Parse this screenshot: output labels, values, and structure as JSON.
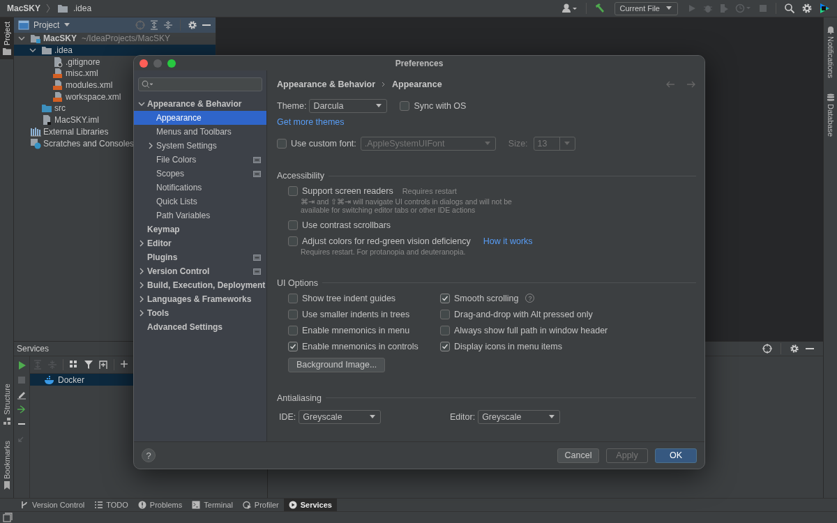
{
  "navbar": {
    "project": "MacSKY",
    "path": ".idea",
    "run_config": "Current File"
  },
  "left_stripe": [
    {
      "label": "Project",
      "kind": "project",
      "selected": true
    },
    {
      "label": "Structure",
      "kind": "structure",
      "selected": false
    },
    {
      "label": "Bookmarks",
      "kind": "bookmarks",
      "selected": false
    }
  ],
  "right_stripe": [
    {
      "label": "Notifications",
      "kind": "bell"
    },
    {
      "label": "Database",
      "kind": "database"
    }
  ],
  "project_panel": {
    "title": "Project",
    "tree": [
      {
        "name": "MacSKY",
        "detail": "~/IdeaProjects/MacSKY",
        "kind": "module",
        "expanded": true,
        "selected": false,
        "children": [
          {
            "name": ".idea",
            "kind": "folder",
            "expanded": true,
            "selected": true,
            "children": [
              {
                "name": ".gitignore",
                "kind": "ignore",
                "selected": false
              },
              {
                "name": "misc.xml",
                "kind": "xml",
                "selected": false
              },
              {
                "name": "modules.xml",
                "kind": "xml",
                "selected": false
              },
              {
                "name": "workspace.xml",
                "kind": "xml",
                "selected": false
              }
            ]
          },
          {
            "name": "src",
            "kind": "source",
            "selected": false
          },
          {
            "name": "MacSKY.iml",
            "kind": "iml",
            "selected": false
          }
        ]
      },
      {
        "name": "External Libraries",
        "kind": "libraries",
        "selected": false
      },
      {
        "name": "Scratches and Consoles",
        "kind": "scratches",
        "selected": false
      }
    ]
  },
  "services_panel": {
    "title": "Services",
    "items": [
      {
        "name": "Docker",
        "selected": true
      }
    ]
  },
  "bottom_tabs": [
    {
      "label": "Version Control",
      "kind": "branch",
      "selected": false
    },
    {
      "label": "TODO",
      "kind": "list",
      "selected": false
    },
    {
      "label": "Problems",
      "kind": "problems",
      "selected": false
    },
    {
      "label": "Terminal",
      "kind": "terminal",
      "selected": false
    },
    {
      "label": "Profiler",
      "kind": "profiler",
      "selected": false
    },
    {
      "label": "Services",
      "kind": "services",
      "selected": true
    }
  ],
  "dialog": {
    "title": "Preferences",
    "nav": [
      {
        "label": "Appearance & Behavior",
        "expanded": true,
        "selected": false,
        "children": [
          {
            "label": "Appearance",
            "selected": true
          },
          {
            "label": "Menus and Toolbars",
            "selected": false
          },
          {
            "label": "System Settings",
            "expanded": false,
            "selected": false
          },
          {
            "label": "File Colors",
            "selected": false,
            "project_level": true
          },
          {
            "label": "Scopes",
            "selected": false,
            "project_level": true
          },
          {
            "label": "Notifications",
            "selected": false
          },
          {
            "label": "Quick Lists",
            "selected": false
          },
          {
            "label": "Path Variables",
            "selected": false
          }
        ]
      },
      {
        "label": "Keymap",
        "selected": false
      },
      {
        "label": "Editor",
        "expanded": false,
        "selected": false
      },
      {
        "label": "Plugins",
        "selected": false,
        "project_level": true
      },
      {
        "label": "Version Control",
        "expanded": false,
        "selected": false,
        "project_level": true
      },
      {
        "label": "Build, Execution, Deployment",
        "expanded": false,
        "selected": false
      },
      {
        "label": "Languages & Frameworks",
        "expanded": false,
        "selected": false
      },
      {
        "label": "Tools",
        "expanded": false,
        "selected": false
      },
      {
        "label": "Advanced Settings",
        "selected": false
      }
    ],
    "breadcrumb": [
      "Appearance & Behavior",
      "Appearance"
    ],
    "theme": {
      "label": "Theme:",
      "value": "Darcula"
    },
    "sync": {
      "label": "Sync with OS",
      "checked": false
    },
    "themes_link": "Get more themes",
    "custom_font": {
      "label": "Use custom font:",
      "checked": false,
      "value": ".AppleSystemUIFont",
      "size_label": "Size:",
      "size": "13"
    },
    "accessibility": {
      "title": "Accessibility",
      "options": [
        {
          "label": "Support screen readers",
          "checked": false,
          "note": "Requires restart",
          "hint": "⌘⇥ and ⇧⌘⇥ will navigate UI controls in dialogs and will not be available for switching editor tabs or other IDE actions"
        },
        {
          "label": "Use contrast scrollbars",
          "checked": false
        },
        {
          "label": "Adjust colors for red-green vision deficiency",
          "checked": false,
          "link": "How it works",
          "hint": "Requires restart. For protanopia and deuteranopia."
        }
      ]
    },
    "ui_options": {
      "title": "UI Options",
      "left": [
        {
          "label": "Show tree indent guides",
          "checked": false
        },
        {
          "label": "Use smaller indents in trees",
          "checked": false
        },
        {
          "label": "Enable mnemonics in menu",
          "checked": false
        },
        {
          "label": "Enable mnemonics in controls",
          "checked": true
        }
      ],
      "right": [
        {
          "label": "Smooth scrolling",
          "checked": true,
          "help": "?"
        },
        {
          "label": "Drag-and-drop with Alt pressed only",
          "checked": false
        },
        {
          "label": "Always show full path in window header",
          "checked": false
        },
        {
          "label": "Display icons in menu items",
          "checked": true
        }
      ],
      "button": "Background Image..."
    },
    "antialiasing": {
      "title": "Antialiasing",
      "ide": {
        "label": "IDE:",
        "value": "Greyscale"
      },
      "editor": {
        "label": "Editor:",
        "value": "Greyscale"
      }
    },
    "help_button": "?",
    "buttons": [
      {
        "label": "Cancel",
        "kind": "normal",
        "disabled": false
      },
      {
        "label": "Apply",
        "kind": "normal",
        "disabled": true
      },
      {
        "label": "OK",
        "kind": "default",
        "disabled": false
      }
    ]
  }
}
